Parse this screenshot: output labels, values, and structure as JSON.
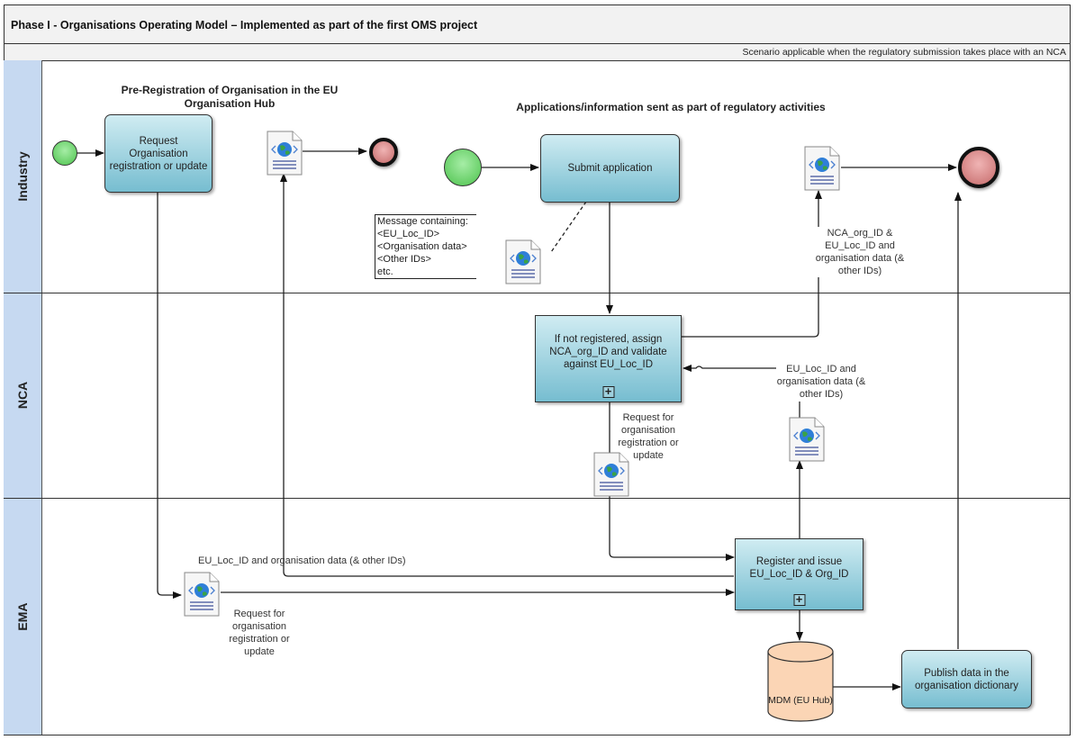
{
  "diagram": {
    "title": "Phase I - Organisations Operating Model – Implemented as part of the first OMS project",
    "scenario": "Scenario applicable when the regulatory submission takes place with an NCA",
    "lanes": [
      {
        "id": "industry",
        "label": "Industry"
      },
      {
        "id": "nca",
        "label": "NCA"
      },
      {
        "id": "ema",
        "label": "EMA"
      }
    ],
    "sections": {
      "pre_registration": "Pre-Registration of Organisation in the EU Organisation Hub",
      "applications": "Applications/information sent as part of regulatory activities"
    },
    "tasks": {
      "request_registration": "Request Organisation registration or update",
      "submit_application": "Submit application",
      "nca_assign": "If not registered, assign NCA_org_ID and validate against EU_Loc_ID",
      "ema_register": "Register and issue EU_Loc_ID & Org_ID",
      "publish": "Publish data in the organisation dictionary"
    },
    "datastore": {
      "label": "MDM (EU Hub)"
    },
    "annotation": {
      "lines": [
        "Message containing:",
        "<EU_Loc_ID>",
        "<Organisation data>",
        "<Other IDs>",
        "etc."
      ]
    },
    "flow_labels": {
      "nca_to_industry": "NCA_org_ID & EU_Loc_ID and organisation data (& other IDs)",
      "ema_to_nca": "EU_Loc_ID and organisation data (& other IDs)",
      "nca_to_ema": "Request for organisation registration or update",
      "ema_to_industry": "EU_Loc_ID and organisation data (& other IDs)",
      "industry_to_ema": "Request for organisation registration or update"
    },
    "plus_marker": "+"
  }
}
